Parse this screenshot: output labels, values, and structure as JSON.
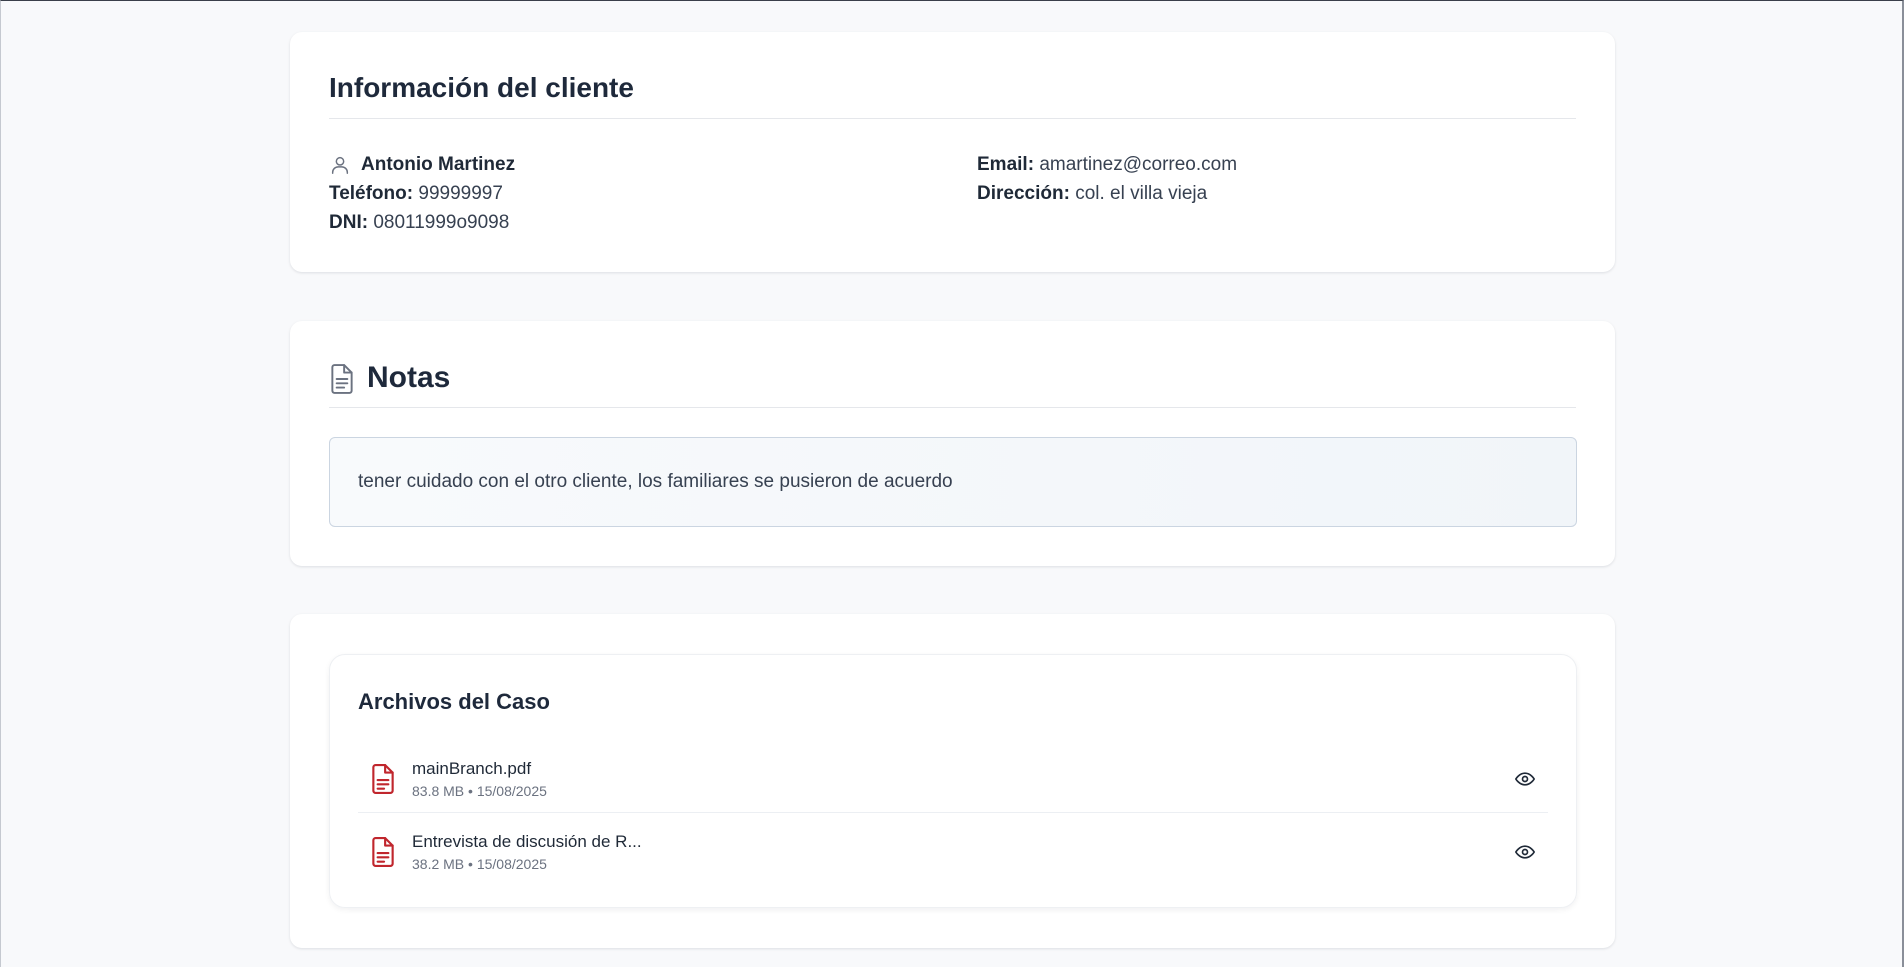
{
  "client": {
    "title": "Información del cliente",
    "name": "Antonio Martinez",
    "phone_label": "Teléfono:",
    "phone": "99999997",
    "dni_label": "DNI:",
    "dni": "08011999o9098",
    "email_label": "Email:",
    "email": "amartinez@correo.com",
    "address_label": "Dirección:",
    "address": "col. el villa vieja"
  },
  "notes": {
    "title": "Notas",
    "text": "tener cuidado con el otro cliente, los familiares se pusieron de acuerdo"
  },
  "files": {
    "title": "Archivos del Caso",
    "items": [
      {
        "name": "mainBranch.pdf",
        "meta": "83.8 MB • 15/08/2025",
        "icon": "pdf-file-icon"
      },
      {
        "name": "Entrevista de discusión de R...",
        "meta": "38.2 MB • 15/08/2025",
        "icon": "pdf-file-icon"
      }
    ]
  },
  "colors": {
    "accent_red": "#c0262d",
    "text_dark": "#1e293b",
    "background": "#f8f9fb"
  }
}
